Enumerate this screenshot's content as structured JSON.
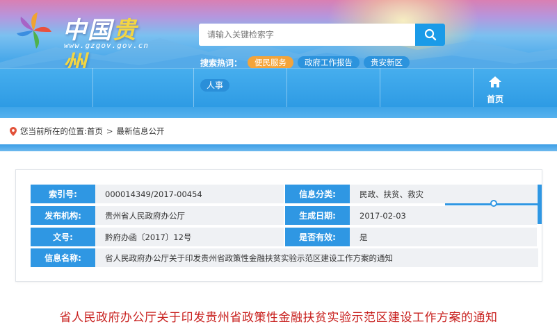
{
  "header": {
    "logo": {
      "text_main": "中国",
      "text_accent": "贵州",
      "url": "www.gzgov.gov.cn"
    },
    "search": {
      "placeholder": "请输入关键检索字",
      "button_icon": "search-icon"
    },
    "hot_search": {
      "label": "搜索热词：",
      "tags": [
        "便民服务",
        "政府工作报告",
        "贵安新区"
      ]
    },
    "nav": {
      "items": [
        "人事"
      ],
      "home_label": "首页",
      "home_icon": "home-icon"
    }
  },
  "breadcrumb": {
    "prefix": "您当前所在的位置:",
    "items": [
      "首页",
      "最新信息公开"
    ],
    "separator": ">",
    "icon": "location-pin-icon"
  },
  "meta": {
    "rows": [
      {
        "l1": "索引号:",
        "v1": "000014349/2017-00454",
        "l2": "信息分类:",
        "v2": "民政、扶贫、救灾"
      },
      {
        "l1": "发布机构:",
        "v1": "贵州省人民政府办公厅",
        "l2": "生成日期:",
        "v2": "2017-02-03"
      },
      {
        "l1": "文号:",
        "v1": "黔府办函〔2017〕12号",
        "l2": "是否有效:",
        "v2": "是"
      }
    ],
    "name_label": "信息名称:",
    "name_value": "省人民政府办公厅关于印发贵州省政策性金融扶贫实验示范区建设工作方案的通知"
  },
  "document": {
    "title": "省人民政府办公厅关于印发贵州省政策性金融扶贫实验示范区建设工作方案的通知"
  },
  "colors": {
    "accent_blue": "#2f97e3",
    "hot_tag_active": "#f4a43a",
    "title_red": "#c8201e"
  }
}
